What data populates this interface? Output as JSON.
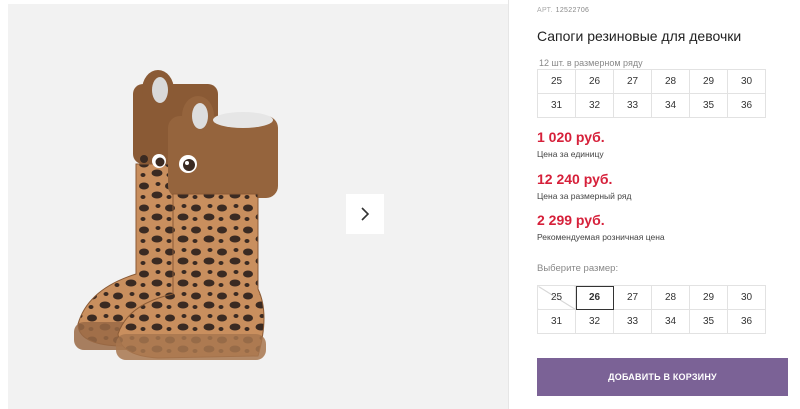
{
  "product": {
    "sku_label": "АРТ.",
    "sku": "12522706",
    "title": "Сапоги резиновые для девочки",
    "range_note": "12 шт. в размерном ряду",
    "range_sizes": [
      [
        "25",
        "26",
        "27",
        "28",
        "29",
        "30"
      ],
      [
        "31",
        "32",
        "33",
        "34",
        "35",
        "36"
      ]
    ]
  },
  "prices": {
    "unit_price": "1 020 руб.",
    "unit_label": "Цена за единицу",
    "range_price": "12 240 руб.",
    "range_label": "Цена за размерный ряд",
    "retail_price": "2 299 руб.",
    "retail_label": "Рекомендуемая розничная цена"
  },
  "size_picker": {
    "label": "Выберите размер:",
    "sizes": [
      [
        "25",
        "26",
        "27",
        "28",
        "29",
        "30"
      ],
      [
        "31",
        "32",
        "33",
        "34",
        "35",
        "36"
      ]
    ],
    "selected": "26",
    "unavailable": [
      "25"
    ]
  },
  "actions": {
    "add_to_cart": "ДОБАВИТЬ В КОРЗИНУ"
  },
  "gallery": {
    "next_icon": "chevron-right-icon"
  },
  "colors": {
    "price": "#d6203a",
    "button": "#7b6296"
  }
}
